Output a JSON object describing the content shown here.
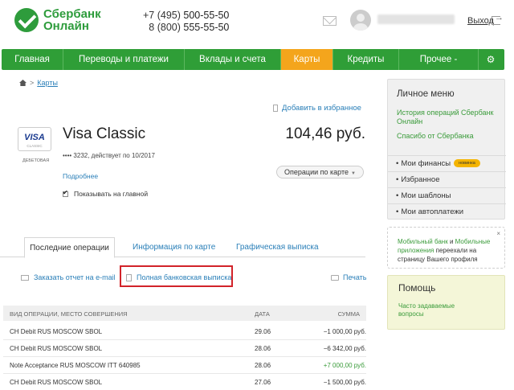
{
  "header": {
    "logo_line1": "Сбербанк",
    "logo_line2": "Онлайн",
    "phone1_prefix": "+7 (495)",
    "phone1_number": "500-55-50",
    "phone2_prefix": "8 (800)",
    "phone2_number": "555-55-50",
    "logout_label": "Выход"
  },
  "nav": {
    "items": [
      {
        "label": "Главная"
      },
      {
        "label": "Переводы и платежи"
      },
      {
        "label": "Вклады и счета"
      },
      {
        "label": "Карты"
      },
      {
        "label": "Кредиты"
      },
      {
        "label": "Прочее -"
      }
    ],
    "active_index": 3,
    "gear_icon": "gear-icon"
  },
  "breadcrumb": {
    "separator": ">",
    "current": "Карты"
  },
  "card": {
    "add_favorite": "Добавить в избранное",
    "logo_text": "VISA",
    "logo_subtext": "CLASSIC",
    "type_label": "ДЕБЕТОВАЯ",
    "title": "Visa Classic",
    "number_info": "•••• 3232, действует по 10/2017",
    "balance": "104,46 руб.",
    "operations_button": "Операции по карте",
    "details_link": "Подробнее",
    "show_main_label": "Показывать на главной"
  },
  "tabs": [
    {
      "label": "Последние операции"
    },
    {
      "label": "Информация по карте"
    },
    {
      "label": "Графическая выписка"
    }
  ],
  "actions": {
    "email_report": "Заказать отчет на e-mail",
    "full_statement": "Полная банковская выписка",
    "print": "Печать"
  },
  "table": {
    "headers": [
      "ВИД ОПЕРАЦИИ, МЕСТО СОВЕРШЕНИЯ",
      "ДАТА",
      "СУММА"
    ],
    "rows": [
      {
        "desc": "CH Debit RUS MOSCOW SBOL",
        "date": "29.06",
        "amount": "−1 000,00 руб."
      },
      {
        "desc": "CH Debit RUS MOSCOW SBOL",
        "date": "28.06",
        "amount": "−6 342,00 руб."
      },
      {
        "desc": "Note Acceptance RUS MOSCOW ITT 640985",
        "date": "28.06",
        "amount": "+7 000,00 руб."
      },
      {
        "desc": "CH Debit RUS MOSCOW SBOL",
        "date": "27.06",
        "amount": "−1 500,00 руб."
      }
    ]
  },
  "personal_menu": {
    "title": "Личное меню",
    "history_link": "История операций Сбербанк Онлайн",
    "thanks_link": "Спасибо от Сбербанка",
    "items": [
      {
        "label": "Мои финансы",
        "badge": "новинка"
      },
      {
        "label": "Избранное"
      },
      {
        "label": "Мои шаблоны"
      },
      {
        "label": "Мои автоплатежи"
      }
    ]
  },
  "mobile": {
    "part1": "Мобильный банк",
    "part2": " и ",
    "part3": "Мобильные приложения",
    "part4": " переехали на страницу Вашего профиля",
    "close": "×"
  },
  "help": {
    "title": "Помощь",
    "faq_link": "Часто задаваемые вопросы"
  },
  "colors": {
    "brand_green": "#2f9e37",
    "active_tab": "#f4a51c",
    "link_blue": "#2a7fb8",
    "highlight_red": "#d2232a",
    "positive_amount": "#3a9b3a"
  }
}
